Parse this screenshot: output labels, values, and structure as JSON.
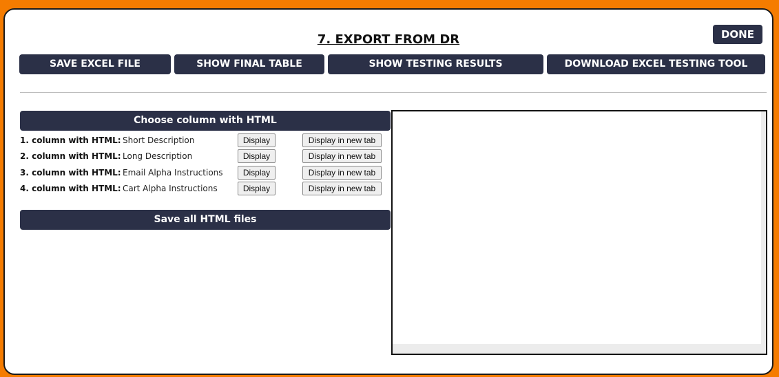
{
  "header": {
    "title": "7. EXPORT FROM DR",
    "done_label": "DONE"
  },
  "toolbar": {
    "buttons": [
      {
        "label": "SAVE EXCEL FILE"
      },
      {
        "label": "SHOW FINAL TABLE"
      },
      {
        "label": "SHOW TESTING RESULTS"
      },
      {
        "label": "DOWNLOAD EXCEL TESTING TOOL"
      }
    ]
  },
  "html_columns": {
    "header": "Choose column with HTML",
    "rows": [
      {
        "label": "1. column with HTML:",
        "value": "Short Description",
        "display_label": "Display",
        "new_tab_label": "Display in new tab"
      },
      {
        "label": "2. column with HTML:",
        "value": "Long Description",
        "display_label": "Display",
        "new_tab_label": "Display in new tab"
      },
      {
        "label": "3. column with HTML:",
        "value": "Email Alpha Instructions",
        "display_label": "Display",
        "new_tab_label": "Display in new tab"
      },
      {
        "label": "4. column with HTML:",
        "value": "Cart Alpha Instructions",
        "display_label": "Display",
        "new_tab_label": "Display in new tab"
      }
    ],
    "save_all_label": "Save all HTML files"
  },
  "colors": {
    "background": "#f57c00",
    "button": "#2b3047",
    "panel": "#ffffff"
  }
}
